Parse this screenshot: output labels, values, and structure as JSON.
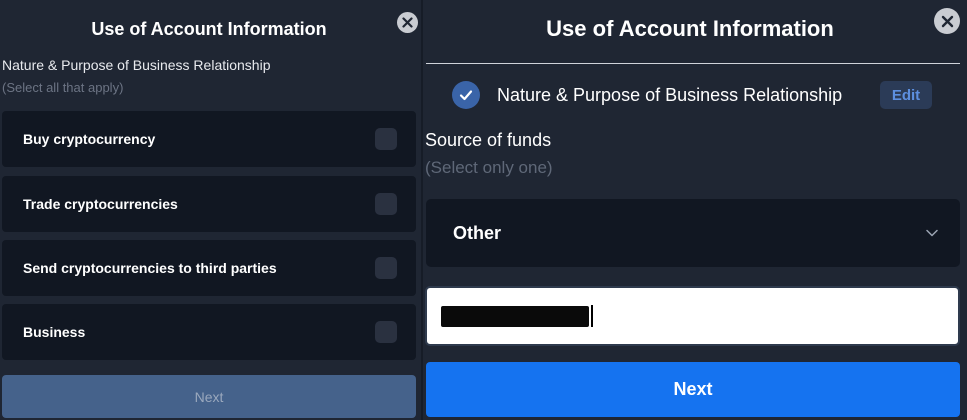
{
  "left": {
    "title": "Use of Account Information",
    "section_label": "Nature & Purpose of Business Relationship",
    "hint": "(Select all that apply)",
    "options": [
      {
        "label": "Buy cryptocurrency",
        "checked": false
      },
      {
        "label": "Trade cryptocurrencies",
        "checked": false
      },
      {
        "label": "Send cryptocurrencies to third parties",
        "checked": false
      },
      {
        "label": "Business",
        "checked": false
      }
    ],
    "next_label": "Next",
    "close_icon": "close-icon"
  },
  "right": {
    "title": "Use of Account Information",
    "completed_step_label": "Nature & Purpose of Business Relationship",
    "edit_label": "Edit",
    "section_label": "Source of funds",
    "hint": "(Select only one)",
    "select_value": "Other",
    "next_label": "Next",
    "icons": [
      "close-icon",
      "check-circle-icon",
      "chevron-down-icon"
    ]
  },
  "colors": {
    "background": "#1f2633",
    "card": "#111722",
    "primary_button": "#1573f0",
    "disabled_button": "#45628b",
    "check_circle": "#3a64a8",
    "edit_text": "#5d8fe0"
  }
}
